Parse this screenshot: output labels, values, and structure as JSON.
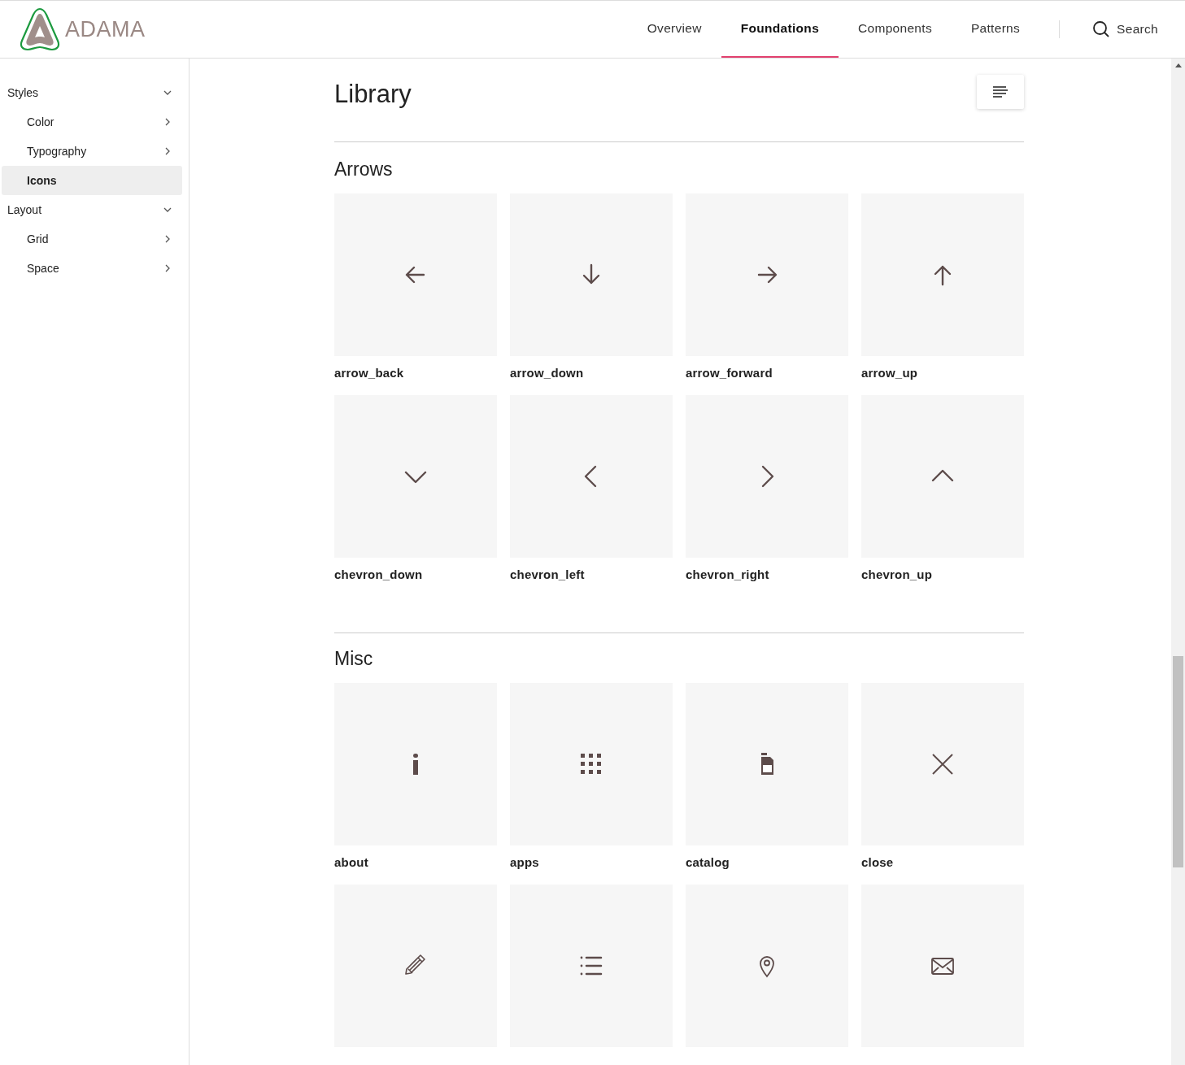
{
  "header": {
    "logo_text": "ADAMA",
    "nav": [
      {
        "label": "Overview",
        "selected": false
      },
      {
        "label": "Foundations",
        "selected": true
      },
      {
        "label": "Components",
        "selected": false
      },
      {
        "label": "Patterns",
        "selected": false
      }
    ],
    "search": {
      "label": "Search"
    }
  },
  "sidebar": {
    "items": [
      {
        "label": "Styles",
        "expanded": true,
        "selected": false,
        "children": [
          {
            "label": "Color",
            "selected": false
          },
          {
            "label": "Typography",
            "selected": false
          },
          {
            "label": "Icons",
            "selected": true
          }
        ]
      },
      {
        "label": "Layout",
        "expanded": true,
        "selected": false,
        "children": [
          {
            "label": "Grid",
            "selected": false
          },
          {
            "label": "Space",
            "selected": false
          }
        ]
      }
    ]
  },
  "page": {
    "title": "Library",
    "sections": [
      {
        "title": "Arrows",
        "icons": [
          {
            "name": "arrow_back",
            "kind": "arrow_back"
          },
          {
            "name": "arrow_down",
            "kind": "arrow_down"
          },
          {
            "name": "arrow_forward",
            "kind": "arrow_forward"
          },
          {
            "name": "arrow_up",
            "kind": "arrow_up"
          },
          {
            "name": "chevron_down",
            "kind": "chevron_down"
          },
          {
            "name": "chevron_left",
            "kind": "chevron_left"
          },
          {
            "name": "chevron_right",
            "kind": "chevron_right"
          },
          {
            "name": "chevron_up",
            "kind": "chevron_up"
          }
        ]
      },
      {
        "title": "Misc",
        "icons": [
          {
            "name": "about",
            "kind": "about"
          },
          {
            "name": "apps",
            "kind": "apps"
          },
          {
            "name": "catalog",
            "kind": "catalog"
          },
          {
            "name": "close",
            "kind": "close"
          },
          {
            "kind": "edit"
          },
          {
            "kind": "list"
          },
          {
            "kind": "location"
          },
          {
            "kind": "mail"
          }
        ]
      }
    ]
  }
}
